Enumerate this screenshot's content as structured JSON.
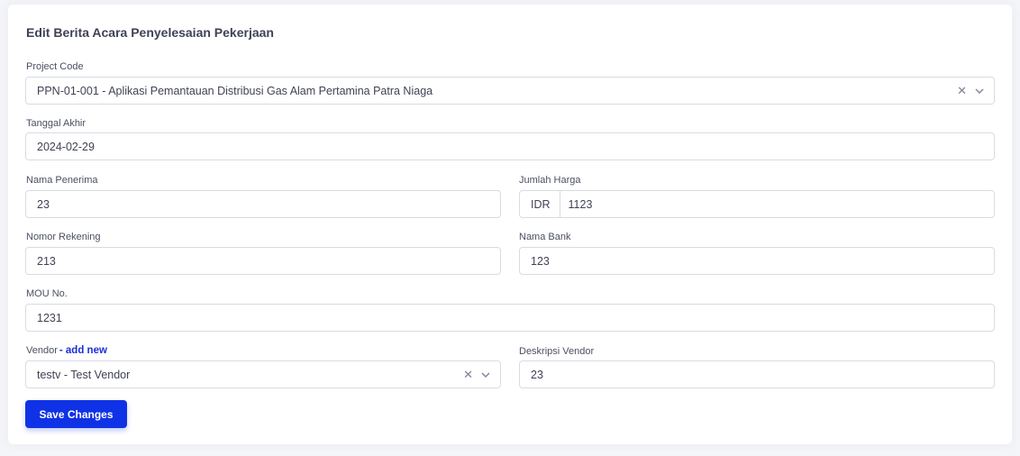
{
  "form": {
    "title": "Edit Berita Acara Penyelesaian Pekerjaan",
    "project_code": {
      "label": "Project Code",
      "value": "PPN-01-001 - Aplikasi Pemantauan Distribusi Gas Alam Pertamina Patra Niaga"
    },
    "tanggal_akhir": {
      "label": "Tanggal Akhir",
      "value": "2024-02-29"
    },
    "nama_penerima": {
      "label": "Nama Penerima",
      "value": "23"
    },
    "jumlah_harga": {
      "label": "Jumlah Harga",
      "prefix": "IDR",
      "value": "1123"
    },
    "nomor_rekening": {
      "label": "Nomor Rekening",
      "value": "213"
    },
    "nama_bank": {
      "label": "Nama Bank",
      "value": "123"
    },
    "mou_no": {
      "label": "MOU No.",
      "value": "1231"
    },
    "vendor": {
      "label": "Vendor",
      "add_new": "- add new",
      "value": "testv - Test Vendor"
    },
    "deskripsi_vendor": {
      "label": "Deskripsi Vendor",
      "value": "23"
    },
    "save_label": "Save Changes"
  },
  "icons": {
    "clear": "close-icon",
    "dropdown": "chevron-down-icon"
  },
  "colors": {
    "primary": "#1032e6",
    "link": "#1a2fd8"
  }
}
